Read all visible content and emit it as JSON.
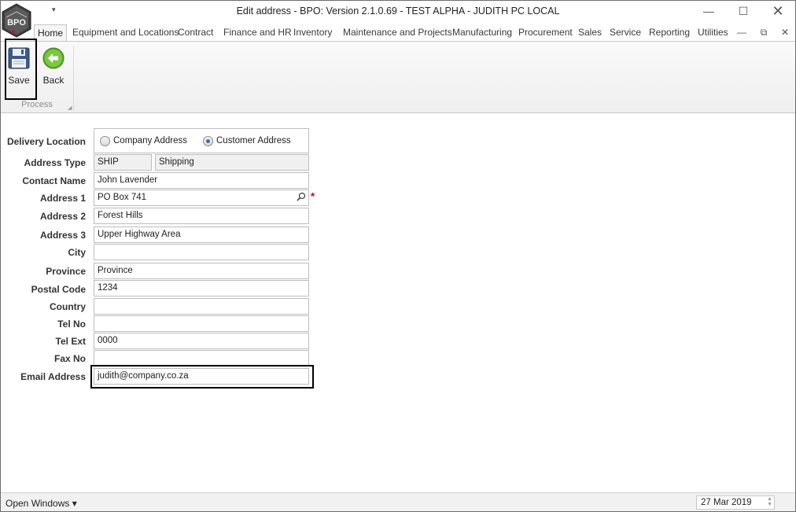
{
  "window": {
    "title": "Edit address - BPO: Version 2.1.0.69 - TEST ALPHA - JUDITH PC LOCAL",
    "logo_text": "BPO",
    "minimize_glyph": "—",
    "maximize_glyph": "☐",
    "close_glyph": "✕",
    "quick_access_glyph": "▾"
  },
  "tabs": [
    {
      "label": "Home",
      "active": true
    },
    {
      "label": "Equipment and Locations"
    },
    {
      "label": "Contract"
    },
    {
      "label": "Finance and HR"
    },
    {
      "label": "Inventory"
    },
    {
      "label": "Maintenance and Projects"
    },
    {
      "label": "Manufacturing"
    },
    {
      "label": "Procurement"
    },
    {
      "label": "Sales"
    },
    {
      "label": "Service"
    },
    {
      "label": "Reporting"
    },
    {
      "label": "Utilities"
    }
  ],
  "mdi_controls": {
    "minimize": "—",
    "restore": "⧉",
    "close": "✕"
  },
  "ribbon": {
    "save_label": "Save",
    "back_label": "Back",
    "group_label": "Process",
    "launcher_glyph": "◢",
    "icons": {
      "save": "floppy-disk-icon",
      "back": "back-arrow-icon"
    }
  },
  "form": {
    "delivery_location": {
      "label": "Delivery Location",
      "options": [
        "Company Address",
        "Customer Address"
      ],
      "selected": "Customer Address"
    },
    "address_type": {
      "label": "Address Type",
      "code": "SHIP",
      "description": "Shipping"
    },
    "contact_name": {
      "label": "Contact Name",
      "value": "John Lavender"
    },
    "address1": {
      "label": "Address 1",
      "value": "PO Box 741",
      "required_mark": "*"
    },
    "address2": {
      "label": "Address 2",
      "value": "Forest Hills"
    },
    "address3": {
      "label": "Address 3",
      "value": "Upper Highway Area"
    },
    "city": {
      "label": "City",
      "value": ""
    },
    "province": {
      "label": "Province",
      "value": "Province"
    },
    "postal_code": {
      "label": "Postal Code",
      "value": "1234"
    },
    "country": {
      "label": "Country",
      "value": ""
    },
    "tel_no": {
      "label": "Tel No",
      "value": ""
    },
    "tel_ext": {
      "label": "Tel Ext",
      "value": "0000"
    },
    "fax_no": {
      "label": "Fax No",
      "value": ""
    },
    "email": {
      "label": "Email Address",
      "value": "judith@company.co.za"
    }
  },
  "status_bar": {
    "open_windows": "Open Windows ▾",
    "date": "27 Mar 2019"
  },
  "colors": {
    "accent": "#3d6fb0",
    "required": "#d00000",
    "back_icon": "#5cad2b",
    "save_icon": "#3a5a8c"
  }
}
